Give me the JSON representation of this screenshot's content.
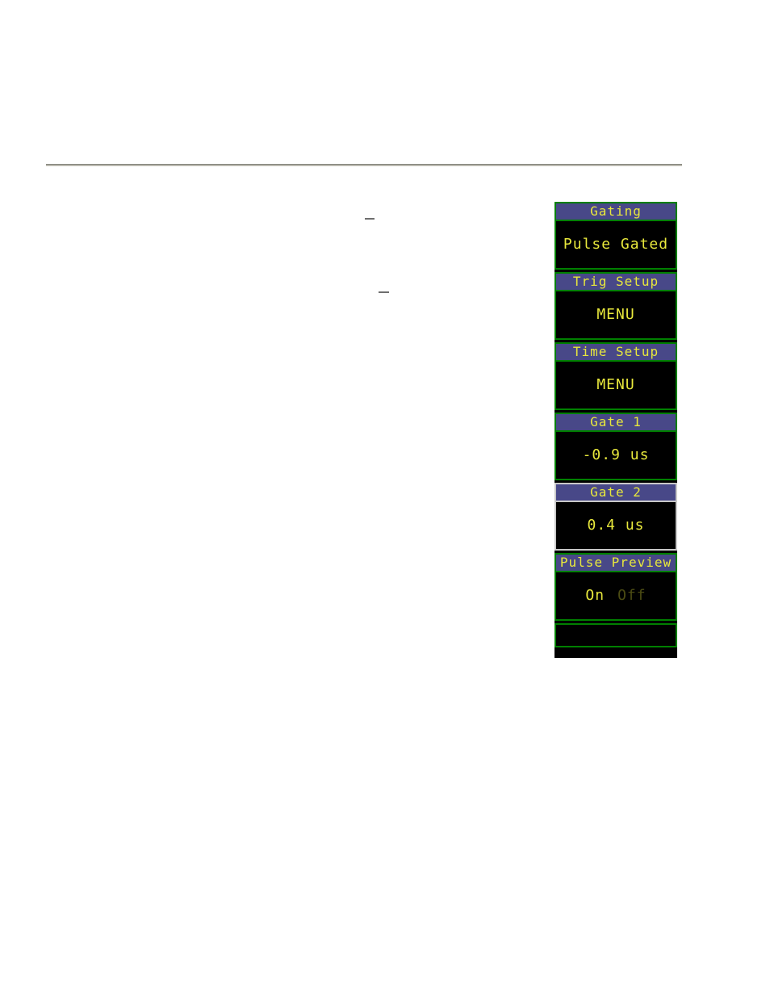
{
  "page": {
    "background_color": "#ffffff",
    "rule_color": "#8b8b83"
  },
  "callouts": [
    {
      "name": "leader-dash-1"
    },
    {
      "name": "leader-dash-2"
    }
  ],
  "menu_panel": {
    "name": "instrument-soft-key-menu",
    "colors": {
      "panel_background": "#000000",
      "header_background": "#484888",
      "header_text": "#e8e83c",
      "value_text": "#e8e83c",
      "frame_green": "#008000",
      "frame_gray": "#c8c8c8"
    },
    "groups": [
      {
        "key": "gating",
        "header": "Gating",
        "value": "Pulse Gated",
        "frame": "green"
      },
      {
        "key": "trig_setup",
        "header": "Trig Setup",
        "value": "MENU",
        "frame": "green"
      },
      {
        "key": "time_setup",
        "header": "Time Setup",
        "value": "MENU",
        "frame": "green"
      },
      {
        "key": "gate_1",
        "header": "Gate 1",
        "value": "-0.9 us",
        "frame": "green"
      },
      {
        "key": "gate_2",
        "header": "Gate 2",
        "value": "0.4 us",
        "frame": "gray"
      },
      {
        "key": "pulse_preview",
        "header": "Pulse Preview",
        "value": "",
        "frame": "green",
        "toggle": {
          "selected": "On",
          "unselected": "Off"
        }
      },
      {
        "key": "empty_softkey",
        "header": "",
        "value": "",
        "frame": "green"
      }
    ]
  }
}
